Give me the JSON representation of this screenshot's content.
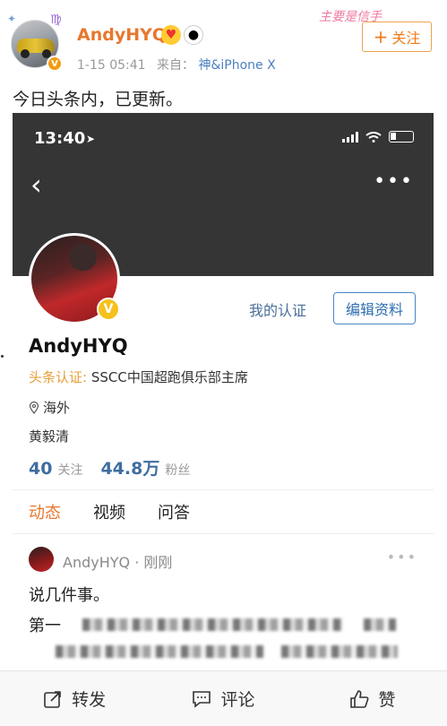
{
  "post": {
    "author": "AndyHYQ",
    "tag": "主要是信手",
    "time": "1-15 05:41",
    "source_prefix": "来自：",
    "source": "神&iPhone X",
    "follow_label": "关注",
    "follow_icon": "+",
    "text": "今日头条内，已更新。"
  },
  "screenshot": {
    "status_time": "13:40",
    "profile": {
      "my_cert_link": "我的认证",
      "edit_label": "编辑资料",
      "name": "AndyHYQ",
      "cert_label": "头条认证:",
      "cert_text": "SSCC中国超跑俱乐部主席",
      "location": "海外",
      "bio": "黄毅清",
      "following_count": "40",
      "following_label": "关注",
      "followers_count": "44.8万",
      "followers_label": "粉丝"
    },
    "tabs": [
      {
        "label": "动态"
      },
      {
        "label": "视频"
      },
      {
        "label": "问答"
      }
    ],
    "feed": {
      "user": "AndyHYQ · 刚刚",
      "line1": "说几件事。",
      "line2_prefix": "第一"
    }
  },
  "actions": {
    "repost": "转发",
    "comment": "评论",
    "like": "赞"
  },
  "colors": {
    "accent_orange": "#e8772e",
    "link_blue": "#4a6e9a",
    "cert_gold": "#e6a03a"
  }
}
